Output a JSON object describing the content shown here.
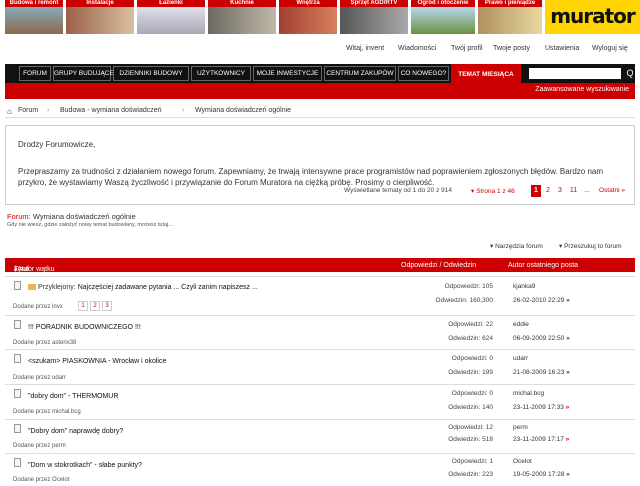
{
  "categories": [
    {
      "label": "Budowa i remont",
      "color": "#8a6a4a"
    },
    {
      "label": "Instalacje",
      "color": "#9a6048"
    },
    {
      "label": "Łazienki",
      "color": "#c8c8d0"
    },
    {
      "label": "Kuchnie",
      "color": "#8a8a80"
    },
    {
      "label": "Wnętrza",
      "color": "#a04030"
    },
    {
      "label": "Sprzęt AGD/RTV",
      "color": "#787878"
    },
    {
      "label": "Ogród i otoczenie",
      "color": "#8aa050"
    },
    {
      "label": "Prawo i pieniądze",
      "color": "#b09060"
    }
  ],
  "logo": "murator",
  "user_links": {
    "welcome": "Witaj, invent",
    "messages": "Wiadomości",
    "profile": "Twój profil",
    "posts": "Twoje posty",
    "settings": "Ustawienia",
    "logout": "Wyloguj się"
  },
  "nav": {
    "items": [
      "FORUM",
      "GRUPY BUDUJĄCE",
      "DZIENNIKI BUDOWY",
      "UŻYTKOWNICY",
      "MOJE INWESTYCJE",
      "CENTRUM ZAKUPÓW",
      "CO NOWEGO?",
      "TEMAT MIESIĄCA"
    ],
    "search_button": "Q",
    "advanced_search": "Zaawansowane wyszukiwanie"
  },
  "breadcrumb": {
    "home": "Forum",
    "level1": "Budowa - wymiana doświadczeń",
    "level2": "Wymiana doświadczeń ogólnie"
  },
  "notice": {
    "greeting": "Drodzy Forumowicze,",
    "body": "Przepraszamy za trudności z działaniem nowego forum. Zapewniamy, że trwają intensywne prace programistów nad poprawieniem zgłoszonych błędów. Bardzo nam przykro, że wystawiamy Waszą życzliwość i przywiązanie do Forum Muratora na ciężką próbę. Prosimy o cierpliwość."
  },
  "pagination": {
    "shown": "Wyświetlane tematy od 1 do 20 z 914",
    "page_label": "Strona 1 z 46",
    "pages": [
      "1",
      "2",
      "3",
      "11",
      "..."
    ],
    "last": "Ostatni"
  },
  "forum": {
    "prefix": "Forum:",
    "name": "Wymiana doświadczeń ogólnie",
    "description": "Gdy nie wiesz, gdzie założyć nowy temat budowlany, możesz tutaj..."
  },
  "tools": {
    "forum_tools": "Narzędzia forum",
    "search_forum": "Przeszukuj to forum"
  },
  "table_header": {
    "title": "Tytuł",
    "author": "/ Autor wątku",
    "replies_views": "Odpowiedzi / Odwiedzin",
    "last_post": "Autor ostatniego posta"
  },
  "threads": [
    {
      "prefix": "Przyklejony:",
      "title": "Najczęściej zadawane pytania ... Czyli zanim napiszesz ...",
      "by": "Dodane przez invx",
      "pages": [
        "1",
        "2",
        "3"
      ],
      "replies": "Odpowiedzi: 105",
      "views": "Odwiedzin: 160,300",
      "last_author": "kjanka9",
      "last_date": "26-02-2010 22:29"
    },
    {
      "prefix": "",
      "title": "!!! PORADNIK BUDOWNICZEGO !!!",
      "by": "Dodane przez asterix38",
      "pages": [],
      "replies": "Odpowiedzi: 22",
      "views": "Odwiedzin: 624",
      "last_author": "eddie",
      "last_date": "06-09-2009 22:50"
    },
    {
      "prefix": "",
      "title": "<szukam> PIASKOWNIA - Wrocław i okolice",
      "by": "Dodane przez udarr",
      "pages": [],
      "replies": "Odpowiedzi: 0",
      "views": "Odwiedzin: 199",
      "last_author": "udarr",
      "last_date": "21-08-2009 16:23"
    },
    {
      "prefix": "",
      "title": "\"dobry dom\" - THERMOMUR",
      "by": "Dodane przez michal.bcg",
      "pages": [],
      "replies": "Odpowiedzi: 0",
      "views": "Odwiedzin: 140",
      "last_author": "michal.bcg",
      "last_date": "23-11-2009 17:33"
    },
    {
      "prefix": "",
      "title": "\"Dobry dom\" naprawdę dobry?",
      "by": "Dodane przez perm",
      "pages": [],
      "replies": "Odpowiedzi: 12",
      "views": "Odwiedzin: 518",
      "last_author": "perm",
      "last_date": "23-11-2009 17:17"
    },
    {
      "prefix": "",
      "title": "\"Dom w stokrotkach\" - słabe punkty?",
      "by": "Dodane przez Ocelot",
      "pages": [],
      "replies": "Odpowiedzi: 1",
      "views": "Odwiedzin: 223",
      "last_author": "Ocelot",
      "last_date": "19-05-2009 17:28"
    }
  ]
}
